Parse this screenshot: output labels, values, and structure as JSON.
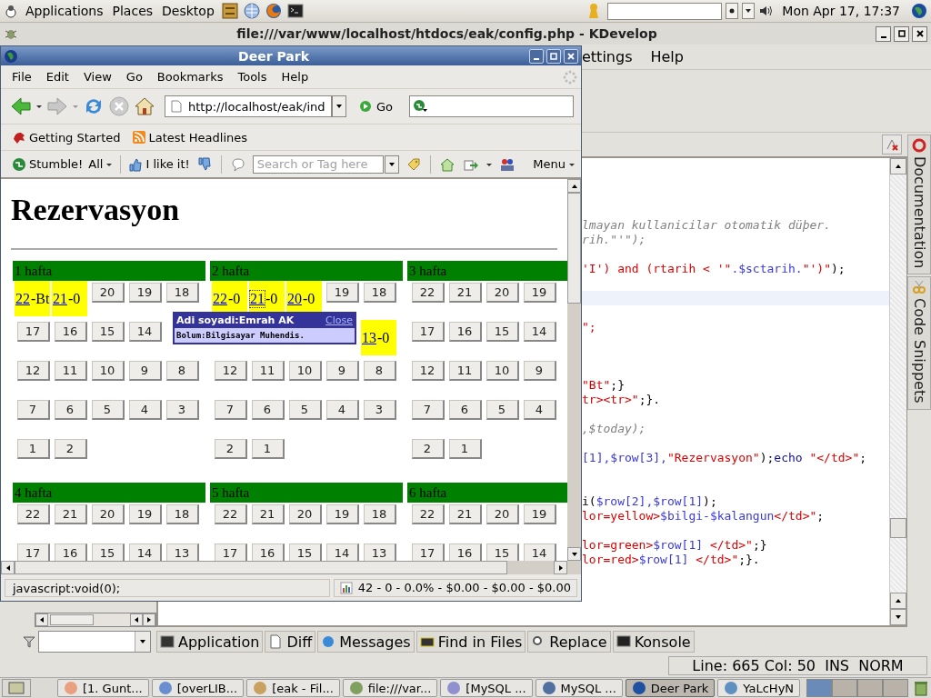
{
  "top_panel": {
    "menus": [
      "Applications",
      "Places",
      "Desktop"
    ],
    "clock": "Mon Apr 17, 17:37"
  },
  "ide": {
    "title": "file:///var/www/localhost/htdocs/eak/config.php - KDevelop",
    "menu": [
      "ettings",
      "Help"
    ],
    "code_lines": [
      {
        "kind": "blank"
      },
      {
        "kind": "blank"
      },
      {
        "kind": "blank"
      },
      {
        "kind": "blank"
      },
      {
        "kind": "code",
        "segments": [
          {
            "text": "lmayan kullanicilar otomatik düþer.",
            "kind": "comment"
          }
        ]
      },
      {
        "kind": "code",
        "segments": [
          {
            "text": "rih.\"'\");",
            "kind": "comment"
          }
        ]
      },
      {
        "kind": "blank"
      },
      {
        "kind": "code",
        "segments": [
          {
            "text": "'I') and (rtarih < '\"",
            "kind": "str"
          },
          {
            "text": ".$sctarih.",
            "kind": "var"
          },
          {
            "text": "\"')\"",
            "kind": "str"
          },
          {
            "text": ");",
            "kind": "plain"
          }
        ]
      },
      {
        "kind": "blank"
      },
      {
        "kind": "current"
      },
      {
        "kind": "blank"
      },
      {
        "kind": "code",
        "segments": [
          {
            "text": "\";",
            "kind": "str"
          }
        ]
      },
      {
        "kind": "blank"
      },
      {
        "kind": "blank"
      },
      {
        "kind": "blank"
      },
      {
        "kind": "code",
        "segments": [
          {
            "text": "\"Bt\"",
            "kind": "str"
          },
          {
            "text": ";}",
            "kind": "plain"
          }
        ]
      },
      {
        "kind": "code",
        "segments": [
          {
            "text": "tr><tr>\"",
            "kind": "str"
          },
          {
            "text": ";}.",
            "kind": "plain"
          }
        ]
      },
      {
        "kind": "blank"
      },
      {
        "kind": "code",
        "segments": [
          {
            "text": ",$today);",
            "kind": "comment"
          }
        ]
      },
      {
        "kind": "blank"
      },
      {
        "kind": "code",
        "segments": [
          {
            "text": "[1],$row[3],",
            "kind": "var"
          },
          {
            "text": "\"Rezervasyon\"",
            "kind": "str"
          },
          {
            "text": ");",
            "kind": "plain"
          },
          {
            "text": "echo",
            "kind": "kw"
          },
          {
            "text": " \"</td>\"",
            "kind": "str"
          },
          {
            "text": ";",
            "kind": "plain"
          }
        ]
      },
      {
        "kind": "blank"
      },
      {
        "kind": "blank"
      },
      {
        "kind": "code",
        "segments": [
          {
            "text": "i(",
            "kind": "plain"
          },
          {
            "text": "$row[2],$row[1]",
            "kind": "var"
          },
          {
            "text": ");",
            "kind": "plain"
          }
        ]
      },
      {
        "kind": "code",
        "segments": [
          {
            "text": "lor=yellow>",
            "kind": "str"
          },
          {
            "text": "$bilgi-$kalangun",
            "kind": "var"
          },
          {
            "text": "</td>\"",
            "kind": "str"
          },
          {
            "text": ";",
            "kind": "plain"
          }
        ]
      },
      {
        "kind": "blank"
      },
      {
        "kind": "code",
        "segments": [
          {
            "text": "lor=green>",
            "kind": "str"
          },
          {
            "text": "$row[1]",
            "kind": "var"
          },
          {
            "text": " </td>\"",
            "kind": "str"
          },
          {
            "text": ";}",
            "kind": "plain"
          }
        ]
      },
      {
        "kind": "code",
        "segments": [
          {
            "text": "lor=red>",
            "kind": "str"
          },
          {
            "text": "$row[1]",
            "kind": "var"
          },
          {
            "text": " </td>\"",
            "kind": "str"
          },
          {
            "text": ";}.",
            "kind": "plain"
          }
        ]
      }
    ],
    "side_tabs": [
      "Documentation",
      "Code Snippets"
    ],
    "tool_tabs": [
      "Application",
      "Diff",
      "Messages",
      "Find in Files",
      "Replace",
      "Konsole"
    ],
    "status": "Line: 665 Col: 50  INS  NORM"
  },
  "browser": {
    "title": "Deer Park",
    "menu": [
      "File",
      "Edit",
      "View",
      "Go",
      "Bookmarks",
      "Tools",
      "Help"
    ],
    "url": "http://localhost/eak/ind",
    "go": "Go",
    "bookmarks": [
      "Getting Started",
      "Latest Headlines"
    ],
    "stumble": {
      "stumble": "Stumble!",
      "all": "All",
      "like": "I like it!",
      "search_placeholder": "Search or Tag here",
      "menu": "Menu"
    },
    "page": {
      "heading": "Rezervasyon",
      "weeks": [
        {
          "title": "1 hafta",
          "rows": [
            [
              {
                "kind": "booked",
                "day": "22",
                "note": "-Bt",
                "focused": false
              },
              {
                "kind": "booked",
                "day": "21",
                "note": "-0",
                "focused": false
              },
              {
                "kind": "button",
                "label": "20"
              },
              {
                "kind": "button",
                "label": "19"
              },
              {
                "kind": "button",
                "label": "18"
              }
            ],
            [
              {
                "kind": "button",
                "label": "17"
              },
              {
                "kind": "button",
                "label": "16"
              },
              {
                "kind": "button",
                "label": "15"
              },
              {
                "kind": "button",
                "label": "14"
              },
              {
                "kind": "covered"
              }
            ],
            [
              {
                "kind": "button",
                "label": "12"
              },
              {
                "kind": "button",
                "label": "11"
              },
              {
                "kind": "button",
                "label": "10"
              },
              {
                "kind": "button",
                "label": "9"
              },
              {
                "kind": "button",
                "label": "8"
              }
            ],
            [
              {
                "kind": "button",
                "label": "7"
              },
              {
                "kind": "button",
                "label": "6"
              },
              {
                "kind": "button",
                "label": "5"
              },
              {
                "kind": "button",
                "label": "4"
              },
              {
                "kind": "button",
                "label": "3"
              }
            ],
            [
              {
                "kind": "button",
                "label": "1"
              },
              {
                "kind": "button",
                "label": "2"
              }
            ]
          ]
        },
        {
          "title": "2 hafta",
          "rows": [
            [
              {
                "kind": "booked",
                "day": "22",
                "note": "-0",
                "focused": false
              },
              {
                "kind": "booked",
                "day": "21",
                "note": "-0",
                "focused": true
              },
              {
                "kind": "booked",
                "day": "20",
                "note": "-0",
                "focused": false
              },
              {
                "kind": "button",
                "label": "19"
              },
              {
                "kind": "button",
                "label": "18"
              }
            ],
            [
              {
                "kind": "covered"
              },
              {
                "kind": "covered"
              },
              {
                "kind": "covered"
              },
              {
                "kind": "covered"
              },
              {
                "kind": "booked",
                "day": "13",
                "note": "-0",
                "focused": false
              }
            ],
            [
              {
                "kind": "button",
                "label": "12"
              },
              {
                "kind": "button",
                "label": "11"
              },
              {
                "kind": "button",
                "label": "10"
              },
              {
                "kind": "button",
                "label": "9"
              },
              {
                "kind": "button",
                "label": "8"
              }
            ],
            [
              {
                "kind": "button",
                "label": "7"
              },
              {
                "kind": "button",
                "label": "6"
              },
              {
                "kind": "button",
                "label": "5"
              },
              {
                "kind": "button",
                "label": "4"
              },
              {
                "kind": "button",
                "label": "3"
              }
            ],
            [
              {
                "kind": "button",
                "label": "2"
              },
              {
                "kind": "button",
                "label": "1"
              }
            ]
          ]
        },
        {
          "title": "3 hafta",
          "rows": [
            [
              {
                "kind": "button",
                "label": "22"
              },
              {
                "kind": "button",
                "label": "21"
              },
              {
                "kind": "button",
                "label": "20"
              },
              {
                "kind": "button",
                "label": "19"
              }
            ],
            [
              {
                "kind": "button",
                "label": "17"
              },
              {
                "kind": "button",
                "label": "16"
              },
              {
                "kind": "button",
                "label": "15"
              },
              {
                "kind": "button",
                "label": "14"
              }
            ],
            [
              {
                "kind": "button",
                "label": "12"
              },
              {
                "kind": "button",
                "label": "11"
              },
              {
                "kind": "button",
                "label": "10"
              },
              {
                "kind": "button",
                "label": "9"
              }
            ],
            [
              {
                "kind": "button",
                "label": "7"
              },
              {
                "kind": "button",
                "label": "6"
              },
              {
                "kind": "button",
                "label": "5"
              },
              {
                "kind": "button",
                "label": "4"
              }
            ],
            [
              {
                "kind": "button",
                "label": "2"
              },
              {
                "kind": "button",
                "label": "1"
              }
            ]
          ]
        },
        {
          "title": "4 hafta",
          "rows": [
            [
              {
                "kind": "button",
                "label": "22"
              },
              {
                "kind": "button",
                "label": "21"
              },
              {
                "kind": "button",
                "label": "20"
              },
              {
                "kind": "button",
                "label": "19"
              },
              {
                "kind": "button",
                "label": "18"
              }
            ],
            [
              {
                "kind": "button",
                "label": "17"
              },
              {
                "kind": "button",
                "label": "16"
              },
              {
                "kind": "button",
                "label": "15"
              },
              {
                "kind": "button",
                "label": "14"
              },
              {
                "kind": "button",
                "label": "13"
              }
            ]
          ]
        },
        {
          "title": "5 hafta",
          "rows": [
            [
              {
                "kind": "button",
                "label": "22"
              },
              {
                "kind": "button",
                "label": "21"
              },
              {
                "kind": "button",
                "label": "20"
              },
              {
                "kind": "button",
                "label": "19"
              },
              {
                "kind": "button",
                "label": "18"
              }
            ],
            [
              {
                "kind": "button",
                "label": "17"
              },
              {
                "kind": "button",
                "label": "16"
              },
              {
                "kind": "button",
                "label": "15"
              },
              {
                "kind": "button",
                "label": "14"
              },
              {
                "kind": "button",
                "label": "13"
              }
            ]
          ]
        },
        {
          "title": "6 hafta",
          "rows": [
            [
              {
                "kind": "button",
                "label": "22"
              },
              {
                "kind": "button",
                "label": "21"
              },
              {
                "kind": "button",
                "label": "20"
              },
              {
                "kind": "button",
                "label": "19"
              }
            ],
            [
              {
                "kind": "button",
                "label": "17"
              },
              {
                "kind": "button",
                "label": "16"
              },
              {
                "kind": "button",
                "label": "15"
              },
              {
                "kind": "button",
                "label": "14"
              }
            ]
          ]
        }
      ],
      "tooltip": {
        "title": "Adi soyadi:Emrah AK",
        "close": "Close",
        "body": "Bolum:Bilgisayar Muhendis."
      }
    },
    "status": "javascript:void(0);",
    "stats": "42 - 0 - 0.0% - $0.00 - $0.00 - $0.00"
  },
  "taskbar": {
    "items": [
      {
        "label": "[1. Gunt...",
        "selected": false
      },
      {
        "label": "[overLIB...",
        "selected": false
      },
      {
        "label": "[eak - Fil...",
        "selected": false
      },
      {
        "label": "file:///var...",
        "selected": false
      },
      {
        "label": "[MySQL ...",
        "selected": false
      },
      {
        "label": "MySQL ...",
        "selected": false
      },
      {
        "label": "Deer Park",
        "selected": true
      },
      {
        "label": "YaLcHyN",
        "selected": false
      }
    ]
  }
}
